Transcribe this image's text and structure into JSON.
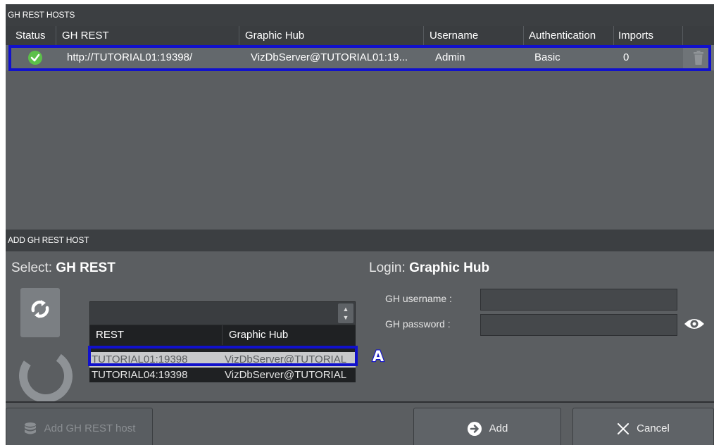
{
  "hosts_section": {
    "title": "GH REST HOSTS",
    "columns": [
      "Status",
      "GH REST",
      "Graphic Hub",
      "Username",
      "Authentication",
      "Imports"
    ],
    "rows": [
      {
        "status": "ok",
        "gh_rest": "http://TUTORIAL01:19398/",
        "graphic_hub": "VizDbServer@TUTORIAL01:19...",
        "username": "Admin",
        "authentication": "Basic",
        "imports": "0"
      }
    ]
  },
  "add_section": {
    "title": "ADD GH REST HOST",
    "select_prefix": "Select:",
    "select_bold": "GH REST",
    "login_prefix": "Login:",
    "login_bold": "Graphic Hub",
    "dropdown_value": "",
    "mini_table": {
      "columns": [
        "REST",
        "Graphic Hub"
      ],
      "rows": [
        {
          "rest": "TUTORIAL01:19398",
          "graphic_hub": "VizDbServer@TUTORIAL"
        },
        {
          "rest": "TUTORIAL04:19398",
          "graphic_hub": "VizDbServer@TUTORIAL"
        }
      ]
    },
    "marker": "A",
    "gh_username_label": "GH username :",
    "gh_password_label": "GH password :",
    "gh_username_value": "",
    "gh_password_value": ""
  },
  "footer": {
    "add_host_label": "Add GH REST host",
    "add_label": "Add",
    "cancel_label": "Cancel"
  },
  "colors": {
    "highlight": "#1111cc",
    "status_ok": "#5cc04a"
  }
}
